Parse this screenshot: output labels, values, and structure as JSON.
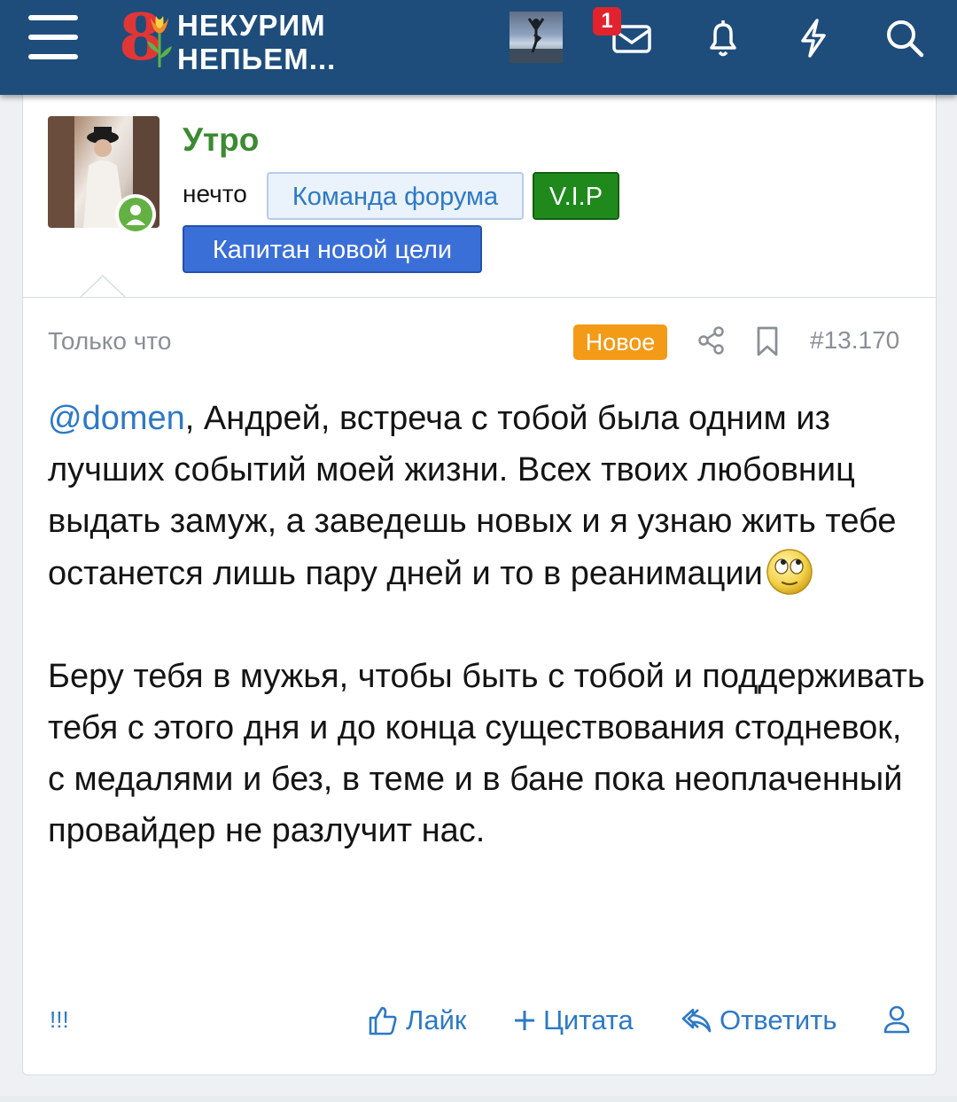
{
  "header": {
    "logo_line1": "НЕКУРИМ",
    "logo_line2": "НЕПЬЕМ...",
    "logo_numeral": "8",
    "notification_count": "1"
  },
  "post": {
    "username": "Утро",
    "user_title": "нечто",
    "badges": [
      "Команда форума",
      "V.I.P",
      "Капитан новой цели"
    ],
    "time": "Только что",
    "new_label": "Новое",
    "post_number": "#13.170",
    "mention": "@domen",
    "paragraph1": ", Андрей, встреча с тобой была одним из лучших событий моей жизни. Всех твоих любовниц выдать замуж, а заведешь новых и я узнаю жить тебе останется лишь пару дней и то в реанимации",
    "paragraph2": "Беру тебя в мужья, чтобы быть с тобой и поддерживать тебя с этого дня и до конца существования стодневок, с медалями и без, в теме и в бане пока неоплаченный провайдер не разлучит нас."
  },
  "actions": {
    "bang": "!!!",
    "like": "Лайк",
    "quote": "Цитата",
    "reply": "Ответить"
  },
  "colors": {
    "header_bg": "#1e4d7b",
    "username": "#3c8a32",
    "link": "#2d79c6",
    "new_pill": "#f39a17",
    "vip": "#1f8a1b",
    "captain": "#3a6fd8"
  }
}
